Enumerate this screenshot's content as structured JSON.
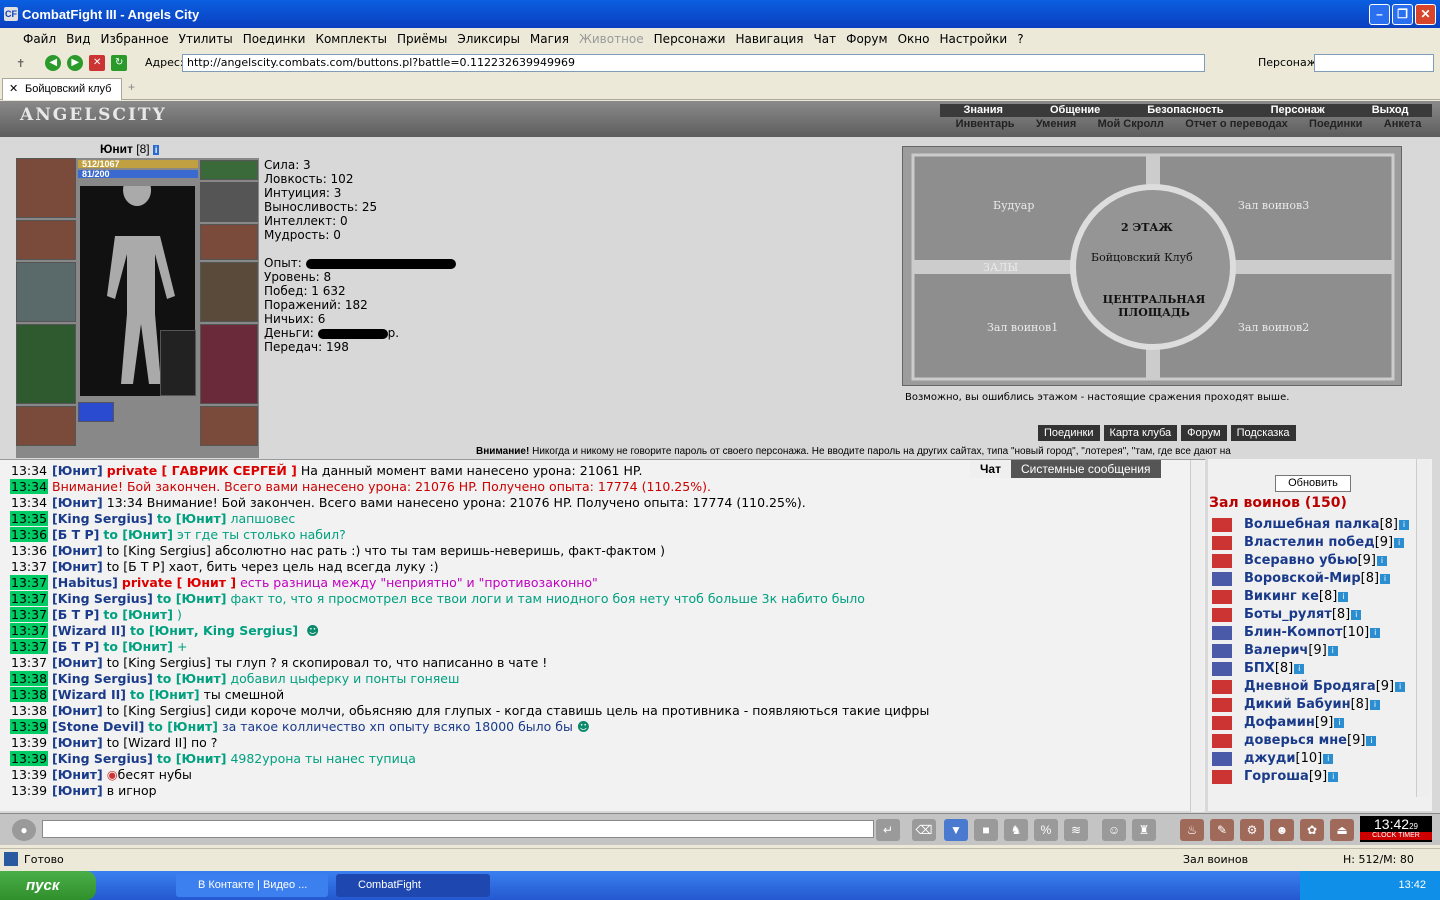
{
  "window": {
    "title": "CombatFight III - Angels City",
    "icon": "CF"
  },
  "menu": [
    "Файл",
    "Вид",
    "Избранное",
    "Утилиты",
    "Поединки",
    "Комплекты",
    "Приёмы",
    "Эликсиры",
    "Магия",
    "Животное",
    "Персонажи",
    "Навигация",
    "Чат",
    "Форум",
    "Окно",
    "Настройки",
    "?"
  ],
  "address": {
    "label": "Адрес:",
    "url": "http://angelscity.combats.com/buttons.pl?battle=0.112232639949969",
    "persona_label": "Персонаж:"
  },
  "tab": {
    "label": "Бойцовский клуб"
  },
  "logo": "ANGELSCITY",
  "nav_top": [
    "Знания",
    "Общение",
    "Безопасность",
    "Персонаж",
    "Выход"
  ],
  "nav_bottom": [
    "Инвентарь",
    "Умения",
    "Мой Скролл",
    "Отчет о переводах",
    "Поединки",
    "Анкета"
  ],
  "character": {
    "name": "Юнит",
    "level": "[8]",
    "hp": "512/1067",
    "mana": "81/200"
  },
  "stats": {
    "sila": "Сила: 3",
    "lovk": "Ловкость: 102",
    "intu": "Интуиция: 3",
    "vyn": "Выносливость: 25",
    "intel": "Интеллект: 0",
    "mudr": "Мудрость: 0",
    "opyt": "Опыт:",
    "uroven": "Уровень: 8",
    "pobed": "Побед: 1 632",
    "porazh": "Поражений: 182",
    "nich": "Ничьих: 6",
    "dengi": "Деньги:",
    "dengi_suffix": "р.",
    "pered": "Передач: 198"
  },
  "map": {
    "boudoir": "Будуар",
    "zal3": "Зал воинов3",
    "floor": "2 ЭТАЖ",
    "club": "Бойцовский Клуб",
    "halls": "ЗАЛЫ",
    "central": "ЦЕНТРАЛЬНАЯ ПЛОЩАДЬ",
    "zal1": "Зал воинов1",
    "zal2": "Зал воинов2"
  },
  "hint": "Возможно, вы ошиблись этажом - настоящие сражения проходят выше.",
  "buttons": [
    "Поединки",
    "Карта клуба",
    "Форум",
    "Подсказка"
  ],
  "warning": {
    "bold": "Внимание!",
    "text": "Никогда и никому не говорите пароль от своего персонажа. Не вводите пароль на других сайтах, типа \"новый город\", \"лотерея\", \"там, где все дают на"
  },
  "chat_tabs": [
    "Чат",
    "Системные сообщения"
  ],
  "messages": [
    {
      "t": "13:34",
      "g": false,
      "n": "[Юнит]",
      "p": "private [ ГАВРИК СЕРГЕЙ ]",
      "m": "На данный момент вами нанесено урона: 21061 HP."
    },
    {
      "t": "13:34",
      "g": true,
      "sys": "Внимание! Бой закончен. Всего вами нанесено урона: 21076 HP. Получено опыта: 17774 (110.25%)."
    },
    {
      "t": "13:34",
      "g": false,
      "n": "[Юнит]",
      "m": "13:34 Внимание! Бой закончен. Всего вами нанесено урона: 21076 HP. Получено опыта: 17774 (110.25%)."
    },
    {
      "t": "13:35",
      "g": true,
      "n": "[King Sergius]",
      "to": "to [Юнит]",
      "m": "лапшовес",
      "c": "#00a080"
    },
    {
      "t": "13:36",
      "g": true,
      "n": "[Б Т Р]",
      "to": "to [Юнит]",
      "m": "эт где ты столько набил?",
      "c": "#00a080"
    },
    {
      "t": "13:36",
      "g": false,
      "n": "[Юнит]",
      "m": "to [King Sergius] абсолютно нас рать :) что ты там веришь-неверишь, факт-фактом )"
    },
    {
      "t": "13:37",
      "g": false,
      "n": "[Юнит]",
      "m": "to [Б Т Р] хаот, бить через цель над всегда луку :)"
    },
    {
      "t": "13:37",
      "g": true,
      "n": "[Habitus]",
      "p": "private [ Юнит ]",
      "m": "есть разница между \"неприятно\" и \"противозаконно\"",
      "c": "#c000c0"
    },
    {
      "t": "13:37",
      "g": true,
      "n": "[King Sergius]",
      "to": "to [Юнит]",
      "m": "факт то, что я просмотрел все твои логи и там ниодного боя нету чтоб больше 3к набито было",
      "c": "#00a080"
    },
    {
      "t": "13:37",
      "g": true,
      "n": "[Б Т Р]",
      "to": "to [Юнит]",
      "m": ")",
      "c": "#00a080"
    },
    {
      "t": "13:37",
      "g": true,
      "n": "[Wizard II]",
      "to": "to [Юнит, King Sergius]",
      "m": "",
      "smile": true
    },
    {
      "t": "13:37",
      "g": true,
      "n": "[Б Т Р]",
      "to": "to [Юнит]",
      "m": "+",
      "c": "#00a080"
    },
    {
      "t": "13:37",
      "g": false,
      "n": "[Юнит]",
      "m": "to [King Sergius] ты глуп ? я скопировал то, что написанно в чате !"
    },
    {
      "t": "13:38",
      "g": true,
      "n": "[King Sergius]",
      "to": "to [Юнит]",
      "m": "добавил цыферку и понты гоняеш",
      "c": "#00a080"
    },
    {
      "t": "13:38",
      "g": true,
      "n": "[Wizard II]",
      "to": "to [Юнит]",
      "m": "ты смешной"
    },
    {
      "t": "13:38",
      "g": false,
      "n": "[Юнит]",
      "m": "to [King Sergius] сиди короче молчи, обьясняю для глупых - когда ставишь цель на противника - появляються такие цифры"
    },
    {
      "t": "13:39",
      "g": true,
      "n": "[Stone Devil]",
      "to": "to [Юнит]",
      "m": "за такое колличество хп опыту всяко 18000 было бы",
      "c": "#1a3a8a",
      "smile": true
    },
    {
      "t": "13:39",
      "g": false,
      "n": "[Юнит]",
      "m": "to [Wizard II] по ?"
    },
    {
      "t": "13:39",
      "g": true,
      "n": "[King Sergius]",
      "to": "to [Юнит]",
      "m": "4982урона ты нанес тупица",
      "c": "#00a080"
    },
    {
      "t": "13:39",
      "g": false,
      "n": "[Юнит]",
      "m": "бесят нубы",
      "icon": true
    },
    {
      "t": "13:39",
      "g": false,
      "n": "[Юнит]",
      "m": "в игнор"
    }
  ],
  "online": {
    "refresh": "Обновить",
    "room": "Зал воинов (150)",
    "users": [
      {
        "n": "Волшебная палка",
        "l": "[8]",
        "b": false
      },
      {
        "n": "Властелин побед",
        "l": "[9]",
        "b": false
      },
      {
        "n": "Всеравно убью",
        "l": "[9]",
        "b": false
      },
      {
        "n": "Воровской-Мир",
        "l": "[8]",
        "b": true
      },
      {
        "n": "Викинг ке",
        "l": "[8]",
        "b": false
      },
      {
        "n": "Боты_рулят",
        "l": "[8]",
        "b": false
      },
      {
        "n": "Блин-Компот",
        "l": "[10]",
        "b": true
      },
      {
        "n": "Валерич",
        "l": "[9]",
        "b": true
      },
      {
        "n": "БПХ",
        "l": "[8]",
        "b": true
      },
      {
        "n": "Дневной Бродяга",
        "l": "[9]",
        "b": false
      },
      {
        "n": "Дикий Бабуин",
        "l": "[8]",
        "b": false
      },
      {
        "n": "Дофамин",
        "l": "[9]",
        "b": false
      },
      {
        "n": "доверься мне",
        "l": "[9]",
        "b": false
      },
      {
        "n": "джуди",
        "l": "[10]",
        "b": true
      },
      {
        "n": "Горгоша",
        "l": "[9]",
        "b": false
      }
    ]
  },
  "clock": {
    "time": "13:42",
    "sec": "29",
    "labels": "CLOCK TIMER"
  },
  "status": {
    "ready": "Готово",
    "room": "Зал воинов",
    "hm": "H: 512/M: 80"
  },
  "taskbar": {
    "start": "пуск",
    "task1": "В Контакте | Видео ...",
    "task2": "CombatFight",
    "time": "13:42"
  }
}
